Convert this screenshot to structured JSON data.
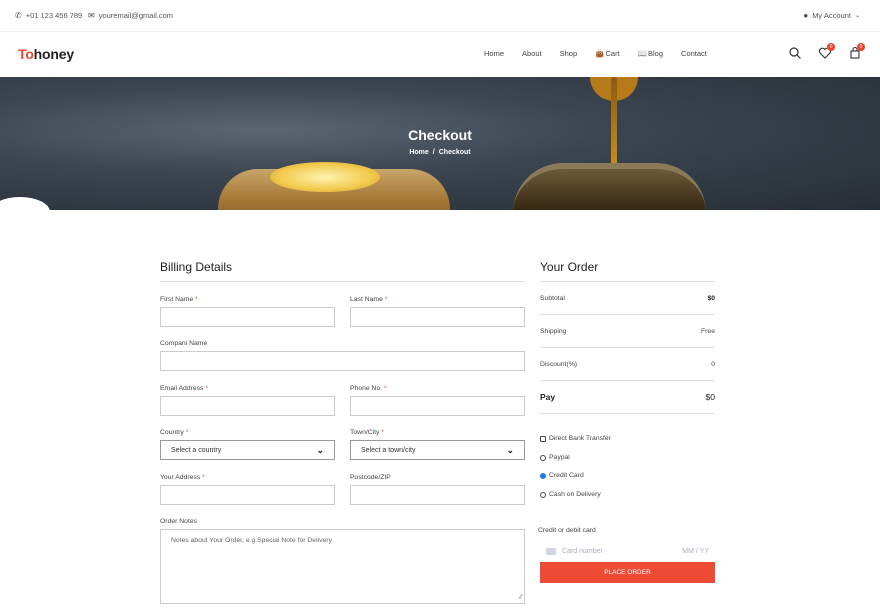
{
  "topbar": {
    "phone": "+01 123 456 789",
    "email": "youremail@gmail.com",
    "account": "My Account"
  },
  "header": {
    "logo_accent": "To",
    "logo_rest": "honey",
    "nav": [
      "Home",
      "About",
      "Shop",
      "Cart",
      "Blog",
      "Contact"
    ],
    "wishlist_count": "0",
    "cart_count": "0"
  },
  "hero": {
    "title": "Checkout",
    "breadcrumb_home": "Home",
    "breadcrumb_sep": "/",
    "breadcrumb_current": "Checkout"
  },
  "billing": {
    "title": "Billing Details",
    "first_name": "First Name",
    "last_name": "Last Name",
    "company": "Compani Name",
    "email": "Email Address",
    "phone": "Phone No.",
    "country": "Country",
    "country_select": "Select a country",
    "town": "Town/City",
    "town_select": "Select a town/city",
    "address": "Your Address",
    "postcode": "Postcode/ZIP",
    "notes": "Order Notes",
    "notes_placeholder": "Notes about Your Order, e.g.Special Note for Delivery",
    "required_mark": "*"
  },
  "order": {
    "title": "Your Order",
    "subtotal_label": "Subtotal",
    "subtotal_value": "$0",
    "shipping_label": "Shipping",
    "shipping_value": "Free",
    "discount_label": "Discount(%)",
    "discount_value": "0",
    "pay_label": "Pay",
    "pay_value": "$0",
    "payment_methods": [
      "Direct Bank Transfer",
      "Paypal",
      "Credit Card",
      "Cash on Delivery"
    ],
    "selected_method": "Credit Card",
    "card_label": "Credit or debit card",
    "card_number_placeholder": "Card number",
    "card_expiry_placeholder": "MM / YY",
    "place_order": "PLACE ORDER"
  },
  "colors": {
    "accent": "#ee4b35",
    "radio_selected": "#1e7be0"
  }
}
